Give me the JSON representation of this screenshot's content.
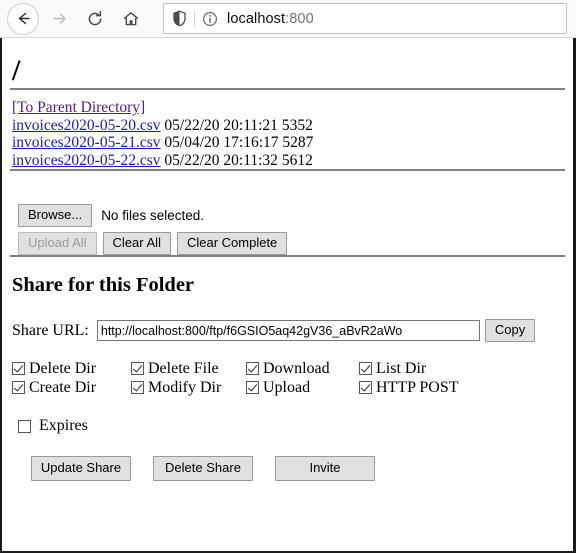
{
  "browser": {
    "back_icon": "back-arrow-icon",
    "forward_icon": "forward-arrow-icon",
    "reload_icon": "reload-icon",
    "home_icon": "home-icon",
    "shield_icon": "shield-icon",
    "info_icon": "info-circle-icon",
    "url_host": "localhost",
    "url_port": ":800"
  },
  "page": {
    "path_heading": "/",
    "listing": {
      "parent_link": "[To Parent Directory]",
      "files": [
        {
          "name": "invoices2020-05-20.csv",
          "date": "05/22/20",
          "time": "20:11:21",
          "size": "5352"
        },
        {
          "name": "invoices2020-05-21.csv",
          "date": "05/04/20",
          "time": "17:16:17",
          "size": "5287"
        },
        {
          "name": "invoices2020-05-22.csv",
          "date": "05/22/20",
          "time": "20:11:32",
          "size": "5612"
        }
      ]
    },
    "upload": {
      "browse_label": "Browse...",
      "no_files_text": "No files selected.",
      "upload_all_label": "Upload All",
      "clear_all_label": "Clear All",
      "clear_complete_label": "Clear Complete"
    },
    "share": {
      "title": "Share for this Folder",
      "url_label": "Share URL:",
      "url_value": "http://localhost:800/ftp/f6GSIO5aq42gV36_aBvR2aWo",
      "copy_label": "Copy",
      "permissions": [
        {
          "label": "Delete Dir",
          "checked": true
        },
        {
          "label": "Delete File",
          "checked": true
        },
        {
          "label": "Download",
          "checked": true
        },
        {
          "label": "List Dir",
          "checked": true
        },
        {
          "label": "Create Dir",
          "checked": true
        },
        {
          "label": "Modify Dir",
          "checked": true
        },
        {
          "label": "Upload",
          "checked": true
        },
        {
          "label": "HTTP POST",
          "checked": true
        }
      ],
      "expires_label": "Expires",
      "expires_checked": false,
      "update_label": "Update Share",
      "delete_label": "Delete Share",
      "invite_label": "Invite"
    }
  },
  "colors": {
    "link": "#1919c4",
    "visited_link": "#551a8b",
    "rule": "#808080",
    "button_face": "#e0e0e0"
  }
}
